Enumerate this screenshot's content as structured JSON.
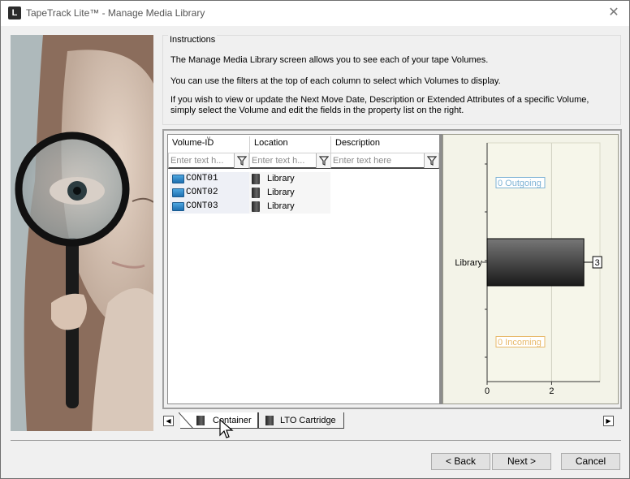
{
  "window": {
    "title": "TapeTrack Lite™ - Manage Media Library",
    "app_icon": "L",
    "close_glyph": "✕"
  },
  "instructions": {
    "legend": "Instructions",
    "line1": "The Manage Media Library screen allows you to see each of your tape Volumes.",
    "line2": "You can use the filters at the top of each column to select which Volumes to display.",
    "line3": "If you wish to view or update the Next Move Date, Description or Extended Attributes of a specific Volume, simply select the Volume and edit the fields in the property list on the right."
  },
  "grid": {
    "columns": [
      "Volume-ID",
      "Location",
      "Description"
    ],
    "filter_placeholders": [
      "Enter text h...",
      "Enter text h...",
      "Enter text here"
    ],
    "rows": [
      {
        "volume_id": "CONT01",
        "location": "Library"
      },
      {
        "volume_id": "CONT02",
        "location": "Library"
      },
      {
        "volume_id": "CONT03",
        "location": "Library"
      }
    ]
  },
  "chart_data": {
    "type": "bar",
    "orientation": "horizontal",
    "categories": [
      "Outgoing",
      "Library",
      "Incoming"
    ],
    "values": [
      0,
      3,
      0
    ],
    "category_labels": [
      "",
      "Library",
      ""
    ],
    "data_labels": [
      "0 Outgoing",
      "3",
      "0 Incoming"
    ],
    "xlim": [
      0,
      3.5
    ],
    "x_ticks": [
      "0",
      "2"
    ],
    "colors": {
      "outgoing": "#7fb3d5",
      "library": "#1a1a1a",
      "incoming": "#e8b96a"
    }
  },
  "tabs": [
    {
      "label": "Container",
      "selected": true
    },
    {
      "label": "LTO Cartridge",
      "selected": false
    }
  ],
  "scroll": {
    "left": "◀",
    "right": "▶"
  },
  "buttons": {
    "back": "< Back",
    "next": "Next >",
    "cancel": "Cancel"
  }
}
